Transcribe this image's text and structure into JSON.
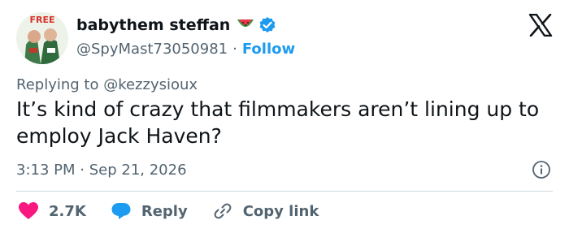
{
  "author": {
    "display_name": "babythem steffan",
    "handle": "@SpyMast73050981",
    "follow_label": "Follow",
    "avatar_ring_text": "FREE"
  },
  "reply_context": "Replying to @kezzysioux",
  "tweet": {
    "text": "It’s kind of crazy that filmmakers aren’t lining up to employ Jack Haven?",
    "time": "3:13 PM",
    "separator": "·",
    "date": "Sep 21, 2026"
  },
  "actions": {
    "likes": "2.7K",
    "reply_label": "Reply",
    "copy_label": "Copy link"
  },
  "colors": {
    "text": "#0f1419",
    "secondary": "#536471",
    "accent": "#1d9bf0",
    "like": "#f91880",
    "divider": "#cfd9de"
  },
  "icons": [
    "watermelon-icon",
    "verified-badge-icon",
    "x-logo-icon",
    "info-icon",
    "heart-icon",
    "reply-bubble-icon",
    "link-icon"
  ]
}
